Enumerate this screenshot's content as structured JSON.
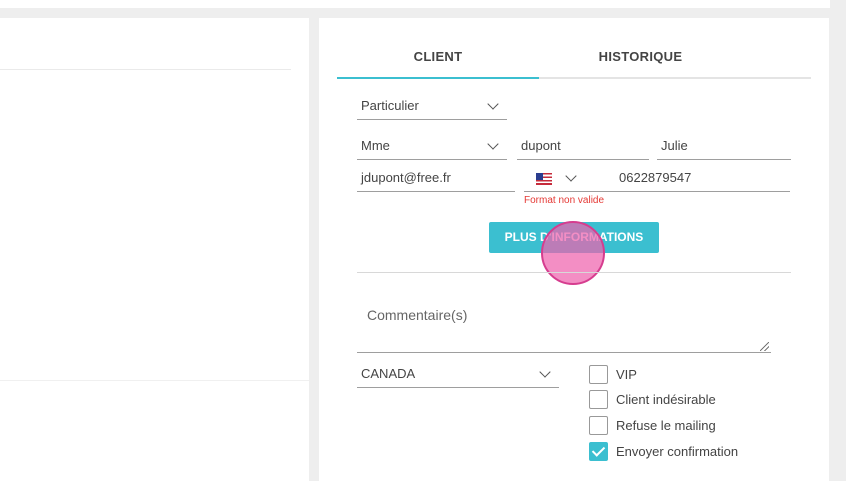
{
  "tabs": [
    {
      "label": "CLIENT"
    },
    {
      "label": "HISTORIQUE"
    }
  ],
  "form": {
    "client_type": "Particulier",
    "civility": "Mme",
    "last_name": "dupont",
    "first_name": "Julie",
    "email": "jdupont@free.fr",
    "phone_country_icon": "us-flag-icon",
    "phone": "0622879547",
    "phone_error": "Format non valide",
    "more_info_button": "PLUS D'INFORMATIONS",
    "comment_placeholder": "Commentaire(s)",
    "country": "CANADA"
  },
  "checkboxes": [
    {
      "label": "VIP",
      "checked": false
    },
    {
      "label": "Client indésirable",
      "checked": false
    },
    {
      "label": "Refuse le mailing",
      "checked": false
    },
    {
      "label": "Envoyer confirmation",
      "checked": true
    }
  ],
  "colors": {
    "accent": "#3bbfd0",
    "error": "#e53935",
    "cursor_highlight": "#ef62ad"
  }
}
